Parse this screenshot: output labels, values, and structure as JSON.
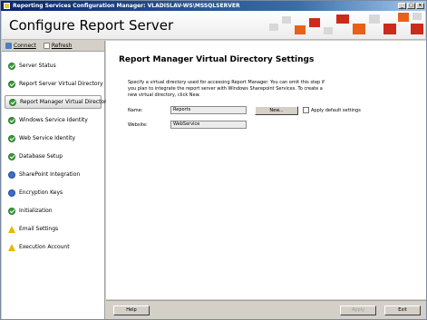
{
  "window": {
    "title": "Reporting Services Configuration Manager: VLADISLAV-WS\\MSSQLSERVER",
    "minimize_label": "_",
    "maximize_label": "□",
    "close_label": "×"
  },
  "banner": {
    "title": "Configure Report Server",
    "colors": [
      "#cc2a1a",
      "#e8601a",
      "#d8d8d8"
    ]
  },
  "toolbar": {
    "connect_label": "Connect",
    "refresh_label": "Refresh"
  },
  "sidebar": {
    "items": [
      {
        "label": "Server Status",
        "icon": "ok-icon"
      },
      {
        "label": "Report Server Virtual Directory",
        "icon": "ok-icon"
      },
      {
        "label": "Report Manager Virtual Directory",
        "icon": "ok-icon"
      },
      {
        "label": "Windows Service Identity",
        "icon": "ok-icon"
      },
      {
        "label": "Web Service Identity",
        "icon": "ok-icon"
      },
      {
        "label": "Database Setup",
        "icon": "ok-icon"
      },
      {
        "label": "SharePoint Integration",
        "icon": "info-icon"
      },
      {
        "label": "Encryption Keys",
        "icon": "info-icon"
      },
      {
        "label": "Initialization",
        "icon": "ok-icon"
      },
      {
        "label": "Email Settings",
        "icon": "warn-icon"
      },
      {
        "label": "Execution Account",
        "icon": "warn-icon"
      }
    ],
    "selected_index": 2
  },
  "main": {
    "heading": "Report Manager Virtual Directory Settings",
    "description": "Specify a virtual directory used for accessing Report Manager. You can omit this step if you plan to integrate the report server with Windows Sharepoint Services. To create a new virtual directory, click New.",
    "name_label": "Name:",
    "name_value": "Reports",
    "new_button": "New...",
    "apply_default_label": "Apply default settings",
    "website_label": "Website:",
    "website_value": "WebService"
  },
  "footer": {
    "help_label": "Help",
    "apply_label": "Apply",
    "exit_label": "Exit"
  }
}
